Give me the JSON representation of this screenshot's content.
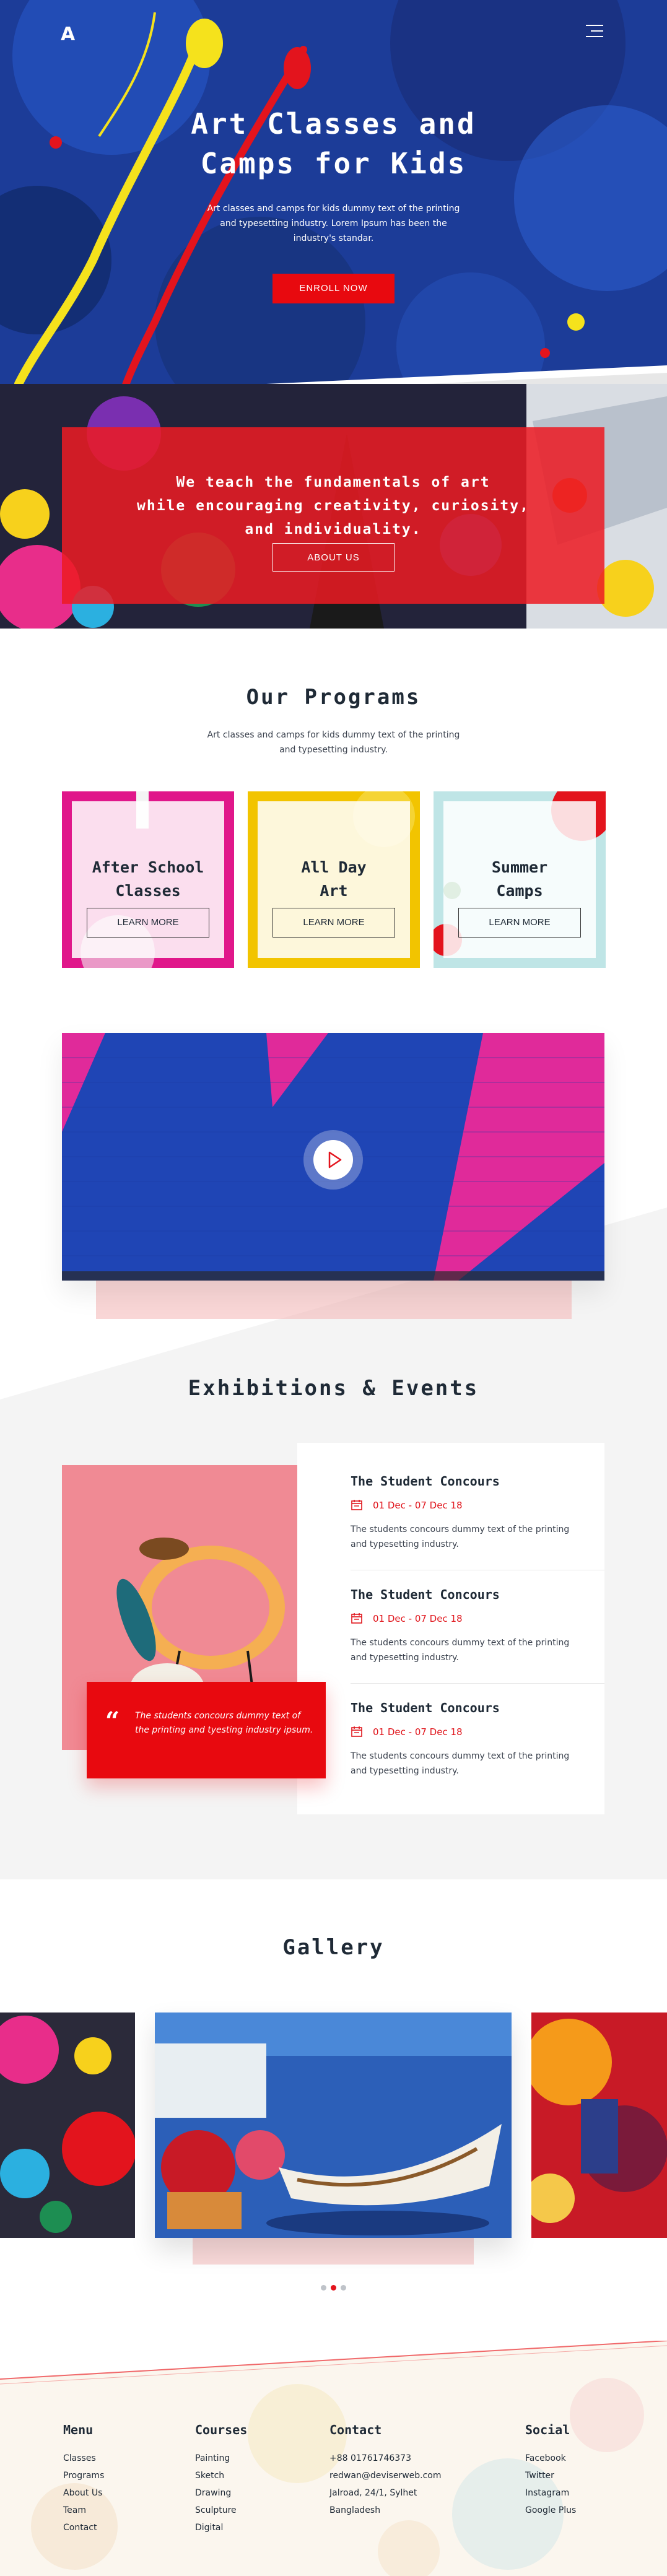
{
  "nav": {
    "logo": "A",
    "menu_icon": "hamburger-menu-icon"
  },
  "hero": {
    "title_line1": "Art Classes and",
    "title_line2": "Camps for Kids",
    "subtitle": "Art classes and camps for kids dummy text of the printing and typesetting industry. Lorem Ipsum has been the industry's standar.",
    "button": "ENROLL NOW"
  },
  "teach": {
    "line1": "We teach the fundamentals of art",
    "line2": "while encouraging creativity, curiosity,",
    "line3": "and individuality.",
    "button": "ABOUT US"
  },
  "programs": {
    "title": "Our Programs",
    "subtitle_line1": "Art classes and camps for kids dummy text of the printing",
    "subtitle_line2": "and typesetting industry.",
    "cards": [
      {
        "title_line1": "After School",
        "title_line2": "Classes",
        "button": "LEARN MORE",
        "color": "#e0178a"
      },
      {
        "title_line1": "All Day",
        "title_line2": "Art",
        "button": "LEARN MORE",
        "color": "#f2c400"
      },
      {
        "title_line1": "Summer",
        "title_line2": "Camps",
        "button": "LEARN MORE",
        "color": "#bfe5e6"
      }
    ]
  },
  "video": {
    "play_icon": "play-icon"
  },
  "exhibitions": {
    "title": "Exhibitions & Events",
    "quote": "The students concours dummy text of the printing and tyesting industry ipsum.",
    "events": [
      {
        "title": "The Student Concours",
        "date": "01 Dec - 07 Dec 18",
        "desc": "The students concours dummy text of the printing and typesetting industry."
      },
      {
        "title": "The Student Concours",
        "date": "01 Dec - 07 Dec 18",
        "desc": "The students concours dummy text of the printing and typesetting industry."
      },
      {
        "title": "The Student Concours",
        "date": "01 Dec - 07 Dec 18",
        "desc": "The students concours dummy text of the printing and typesetting industry."
      }
    ]
  },
  "gallery": {
    "title": "Gallery",
    "active_dot": 1
  },
  "footer": {
    "menu": {
      "heading": "Menu",
      "links": [
        "Classes",
        "Programs",
        "About Us",
        "Team",
        "Contact"
      ]
    },
    "courses": {
      "heading": "Courses",
      "links": [
        "Painting",
        "Sketch",
        "Drawing",
        "Sculpture",
        "Digital"
      ]
    },
    "contact": {
      "heading": "Contact",
      "links": [
        "+88 01761746373",
        "redwan@deviserweb.com",
        "Jalroad, 24/1, Sylhet",
        "Bangladesh"
      ]
    },
    "social": {
      "heading": "Social",
      "links": [
        "Facebook",
        "Twitter",
        "Instagram",
        "Google Plus"
      ]
    }
  },
  "colors": {
    "accent": "#e8090f",
    "dark_text": "#1f2a36",
    "hero_blue": "#1d3f9e",
    "light_grey_bg": "#f4f4f4"
  }
}
